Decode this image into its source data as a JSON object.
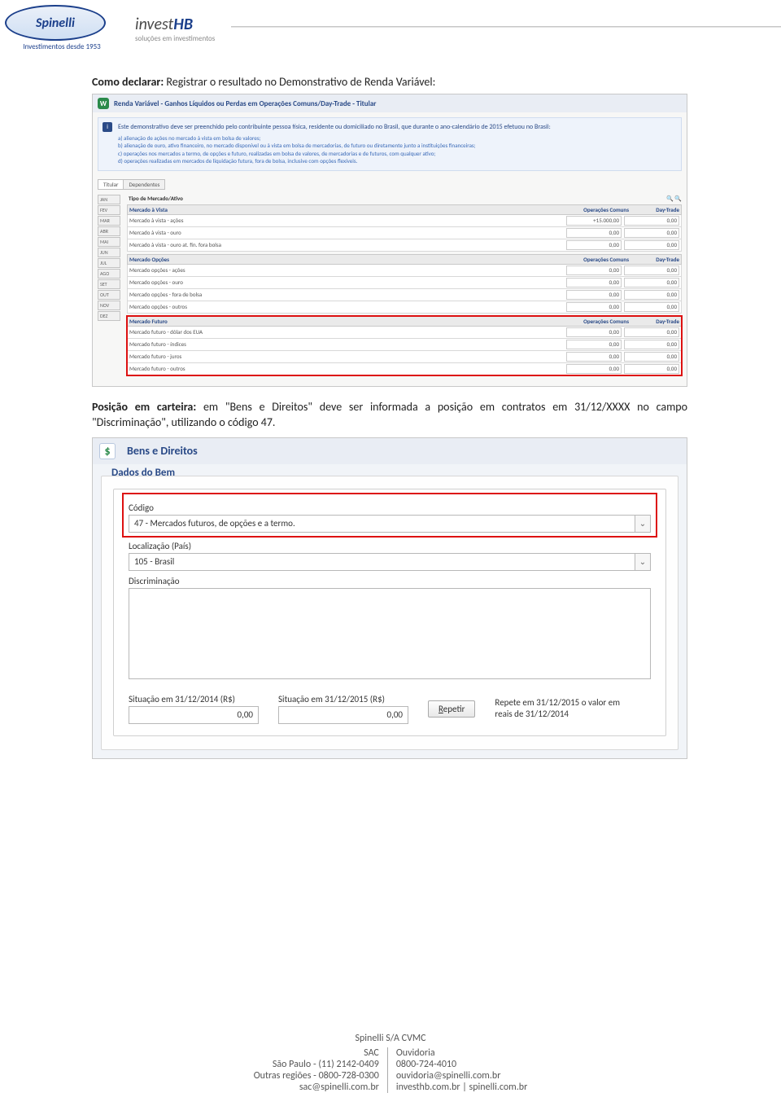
{
  "header": {
    "logo1": {
      "name": "Spinelli",
      "tagline": "Investimentos desde 1953"
    },
    "logo2": {
      "name": "investHB",
      "tagline": "soluções em investimentos"
    }
  },
  "body": {
    "p1": {
      "bold": "Como declarar:",
      "rest": "Registrar o resultado no Demonstrativo de Renda Variável:"
    },
    "p2": {
      "bold": "Posição em carteira:",
      "rest": "em \"Bens e Direitos\" deve ser informada a posição em contratos em 31/12/XXXX no campo \"Discriminação\", utilizando o código 47."
    }
  },
  "panel1": {
    "title": "Renda Variável - Ganhos Líquidos ou Perdas em Operações Comuns/Day-Trade - Titular",
    "info_main": "Este demonstrativo deve ser preenchido pelo contribuinte pessoa física, residente ou domiciliado no Brasil, que durante o ano-calendário de 2015 efetuou no Brasil:",
    "info_lines": [
      "a) alienação de ações no mercado à vista em bolsa de valores;",
      "b) alienação de ouro, ativo financeiro, no mercado disponível ou à vista em bolsa de mercadorias, de futuro ou diretamente junto a instituições financeiras;",
      "c) operações nos mercados a termo, de opções e futuro, realizadas em bolsa de valores, de mercadorias e de futuros, com qualquer ativo;",
      "d) operações realizadas em mercados de liquidação futura, fora de bolsa, inclusive com opções flexíveis."
    ],
    "tabs": [
      "Titular",
      "Dependentes"
    ],
    "months": [
      "JAN",
      "FEV",
      "MAR",
      "ABR",
      "MAI",
      "JUN",
      "JUL",
      "AGO",
      "SET",
      "OUT",
      "NOV",
      "DEZ"
    ],
    "fieldset_title": "Tipo de Mercado/Ativo",
    "col_labels": [
      "Operações Comuns",
      "Day-Trade"
    ],
    "groups": [
      {
        "title": "Mercado à Vista",
        "rows": [
          {
            "label": "Mercado à vista - ações",
            "op": "+15.000,00",
            "dt": "0,00"
          },
          {
            "label": "Mercado à vista - ouro",
            "op": "0,00",
            "dt": "0,00"
          },
          {
            "label": "Mercado à vista - ouro at. fin. fora bolsa",
            "op": "0,00",
            "dt": "0,00"
          }
        ]
      },
      {
        "title": "Mercado Opções",
        "rows": [
          {
            "label": "Mercado opções - ações",
            "op": "0,00",
            "dt": "0,00"
          },
          {
            "label": "Mercado opções - ouro",
            "op": "0,00",
            "dt": "0,00"
          },
          {
            "label": "Mercado opções - fora de bolsa",
            "op": "0,00",
            "dt": "0,00"
          },
          {
            "label": "Mercado opções - outros",
            "op": "0,00",
            "dt": "0,00"
          }
        ]
      },
      {
        "title": "Mercado Futuro",
        "rows": [
          {
            "label": "Mercado futuro - dólar dos EUA",
            "op": "0,00",
            "dt": "0,00"
          },
          {
            "label": "Mercado futuro - índices",
            "op": "0,00",
            "dt": "0,00"
          },
          {
            "label": "Mercado futuro - juros",
            "op": "0,00",
            "dt": "0,00"
          },
          {
            "label": "Mercado futuro - outros",
            "op": "0,00",
            "dt": "0,00"
          }
        ]
      }
    ]
  },
  "panel2": {
    "title": "Bens e Direitos",
    "section": "Dados do Bem",
    "codigo_label": "Código",
    "codigo_value": "47 - Mercados futuros, de opções e a termo.",
    "local_label": "Localização (País)",
    "local_value": "105 - Brasil",
    "disc_label": "Discriminação",
    "sit14_label": "Situação em 31/12/2014 (R$)",
    "sit14_value": "0,00",
    "sit15_label": "Situação em 31/12/2015 (R$)",
    "sit15_value": "0,00",
    "repeat_btn": "epetir",
    "repeat_text": "Repete em 31/12/2015 o valor em reais de 31/12/2014"
  },
  "footer": {
    "company": "Spinelli S/A CVMC",
    "left": {
      "title": "SAC",
      "line1": "São Paulo - (11) 2142-0409",
      "line2": "Outras regiões - 0800-728-0300",
      "line3": "sac@spinelli.com.br"
    },
    "right": {
      "title": "Ouvidoria",
      "line1": "0800-724-4010",
      "line2": "ouvidoria@spinelli.com.br",
      "line3": "investhb.com.br | spinelli.com.br"
    }
  }
}
